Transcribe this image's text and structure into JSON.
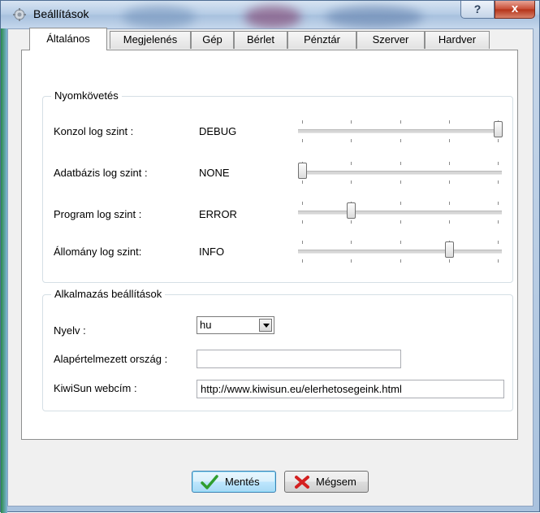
{
  "window": {
    "title": "Beállítások",
    "help_glyph": "?",
    "close_glyph": "x"
  },
  "tabs": [
    "Általános",
    "Megjelenés",
    "Gép",
    "Bérlet",
    "Pénztár",
    "Szerver",
    "Hardver"
  ],
  "active_tab": "Általános",
  "logging": {
    "group_title": "Nyomkövetés",
    "rows": [
      {
        "label": "Konzol log szint :",
        "level": "DEBUG",
        "position": 4
      },
      {
        "label": "Adatbázis log szint :",
        "level": "NONE",
        "position": 0
      },
      {
        "label": "Program log szint :",
        "level": "ERROR",
        "position": 1
      },
      {
        "label": "Állomány log szint:",
        "level": "INFO",
        "position": 3
      }
    ],
    "slider_steps": 5
  },
  "app_settings": {
    "group_title": "Alkalmazás beállítások",
    "language_label": "Nyelv :",
    "language_value": "hu",
    "country_label": "Alapértelmezett ország :",
    "country_value": "",
    "web_label": "KiwiSun webcím :",
    "web_value": "http://www.kiwisun.eu/elerhetosegeink.html"
  },
  "buttons": {
    "save": "Mentés",
    "cancel": "Mégsem"
  }
}
